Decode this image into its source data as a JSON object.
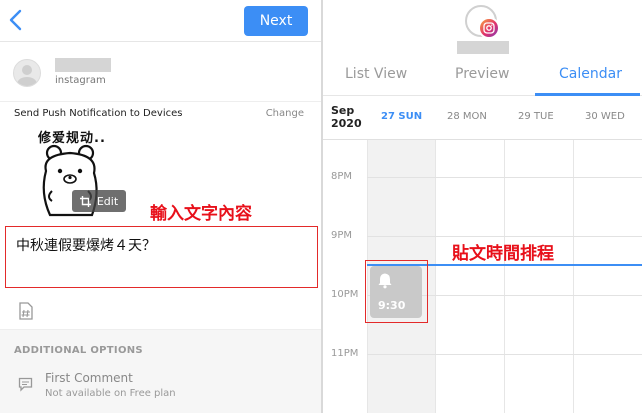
{
  "left": {
    "next_label": "Next",
    "account": {
      "network": "instagram"
    },
    "push": {
      "label": "Send Push Notification to Devices",
      "change": "Change"
    },
    "sticker": {
      "caption": "修爱规动..",
      "edit_label": "Edit"
    },
    "annotation_text": "輸入文字內容",
    "caption_text": "中秋連假要爆烤４天？",
    "additional_options": {
      "header": "ADDITIONAL OPTIONS",
      "first_comment": {
        "title": "First Comment",
        "subtitle": "Not available on Free plan"
      }
    }
  },
  "right": {
    "tabs": [
      {
        "label": "List View"
      },
      {
        "label": "Preview"
      },
      {
        "label": "Calendar"
      }
    ],
    "calendar": {
      "month": "Sep",
      "year": "2020",
      "days": [
        "27 SUN",
        "28 MON",
        "29 TUE",
        "30 WED"
      ],
      "hours": [
        "8PM",
        "9PM",
        "10PM",
        "11PM"
      ],
      "event": {
        "time": "9:30"
      }
    },
    "annotation_text": "貼文時間排程"
  },
  "colors": {
    "accent": "#3c8ef5",
    "annotation": "#e8101a"
  }
}
